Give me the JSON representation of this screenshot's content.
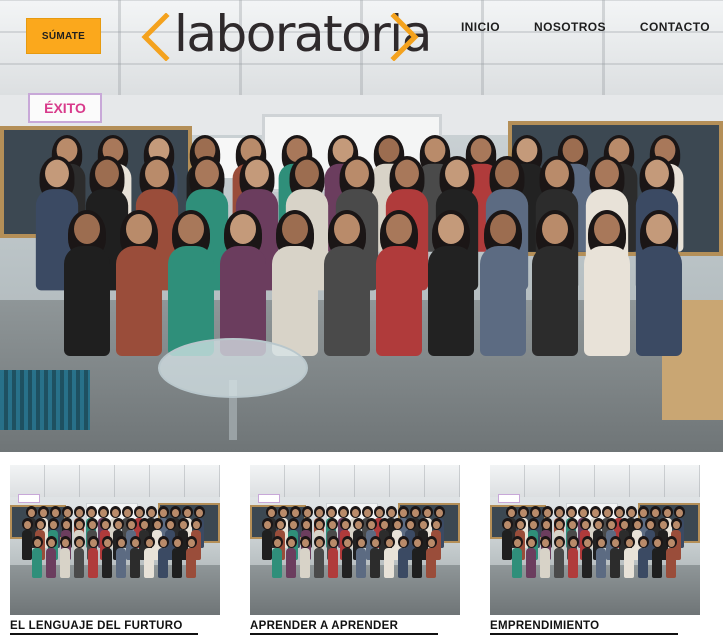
{
  "header": {
    "join_button": "SÚMATE",
    "logo_text": "laboratoria",
    "nav": [
      {
        "label": "INICIO"
      },
      {
        "label": "NOSOTROS"
      },
      {
        "label": "CONTACTO"
      }
    ]
  },
  "hero": {
    "poster_text": "ÉXITO"
  },
  "cards": [
    {
      "title": "EL LENGUAJE DEL FURTURO"
    },
    {
      "title": "APRENDER A APRENDER"
    },
    {
      "title": "EMPRENDIMIENTO"
    }
  ],
  "colors": {
    "accent": "#fba81c",
    "logo_bracket": "#f4a21e",
    "text_dark": "#1e1e1e"
  }
}
